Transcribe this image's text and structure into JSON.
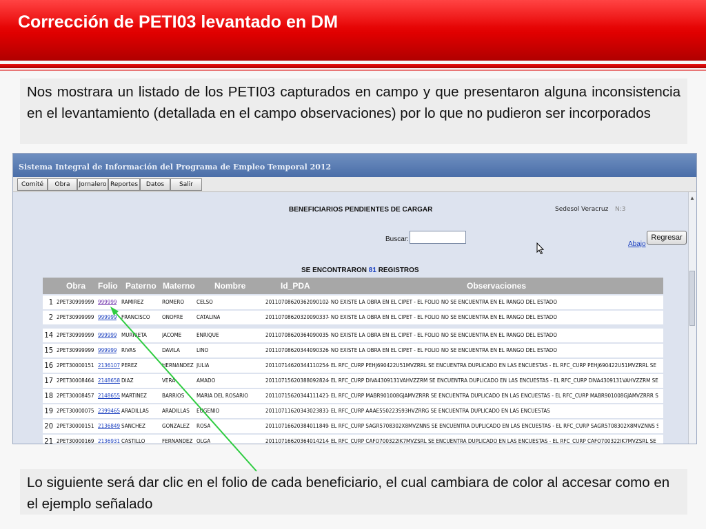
{
  "slide": {
    "title": "Corrección de PETI03 levantado en DM",
    "intro_text": "Nos mostrara un listado de los PETI03 capturados en campo y que presentaron alguna inconsistencia en el levantamiento (detallada en el campo observaciones) por lo que no pudieron ser incorporados",
    "footer_text": "Lo siguiente será dar clic en el folio de cada beneficiario, el cual cambiara de color al accesar como en el ejemplo señalado"
  },
  "app": {
    "title": "Sistema Integral de Información del Programa de Empleo Temporal 2012",
    "toolbar": [
      "Comité",
      "Obra",
      "Jornalero",
      "Reportes",
      "Datos",
      "Salir"
    ],
    "user": "Sedesol Veracruz",
    "user_suffix": "N:3"
  },
  "page": {
    "heading": "BENEFICIARIOS PENDIENTES DE CARGAR",
    "search_label": "Buscar:",
    "search_value": "",
    "back_button": "Regresar",
    "down_link": "Abajo",
    "count_prefix": "SE ENCONTRARON",
    "count": "81",
    "count_suffix": "REGISTROS"
  },
  "table": {
    "columns": [
      "Obra",
      "Folio",
      "Paterno",
      "Materno",
      "Nombre",
      "Id_PDA",
      "Observaciones"
    ],
    "rows": [
      {
        "n": "1",
        "obra": "2PET30999999",
        "folio": "999999",
        "paterno": "RAMIREZ",
        "materno": "ROMERO",
        "nombre": "CELSO",
        "id": "20110708620362090102",
        "obs": "- NO EXISTE LA OBRA EN EL CIPET - EL FOLIO NO SE ENCUENTRA EN EL RANGO DEL ESTADO",
        "visited": true
      },
      {
        "n": "2",
        "obra": "2PET30999999",
        "folio": "999999",
        "paterno": "FRANCISCO",
        "materno": "ONOFRE",
        "nombre": "CATALINA",
        "id": "20110708620320090337",
        "obs": "- NO EXISTE LA OBRA EN EL CIPET - EL FOLIO NO SE ENCUENTRA EN EL RANGO DEL ESTADO",
        "visited": false
      },
      {
        "n": "14",
        "obra": "2PET30999999",
        "folio": "999999",
        "paterno": "MURRIETA",
        "materno": "JACOME",
        "nombre": "ENRIQUE",
        "id": "20110708620364090035",
        "obs": "- NO EXISTE LA OBRA EN EL CIPET - EL FOLIO NO SE ENCUENTRA EN EL RANGO DEL ESTADO",
        "visited": false
      },
      {
        "n": "15",
        "obra": "2PET30999999",
        "folio": "999999",
        "paterno": "RIVAS",
        "materno": "DAVILA",
        "nombre": "LINO",
        "id": "20110708620344090326",
        "obs": "- NO EXISTE LA OBRA EN EL CIPET - EL FOLIO NO SE ENCUENTRA EN EL RANGO DEL ESTADO",
        "visited": false
      },
      {
        "n": "16",
        "obra": "2PET30000151",
        "folio": "2136107",
        "paterno": "PEREZ",
        "materno": "HERNANDEZ",
        "nombre": "JULIA",
        "id": "20110714620344110254",
        "obs": "- EL RFC_CURP PEHJ690422U51MVZRRL SE ENCUENTRA DUPLICADO EN LAS ENCUESTAS - EL RFC_CURP PEHJ690422U51MVZRRL SE",
        "visited": false
      },
      {
        "n": "17",
        "obra": "2PET30008464",
        "folio": "2148658",
        "paterno": "DIAZ",
        "materno": "VERA",
        "nombre": "AMADO",
        "id": "20110715620388092824",
        "obs": "- EL RFC_CURP DIVA4309131VAHVZZRM SE ENCUENTRA DUPLICADO EN LAS ENCUESTAS - EL RFC_CURP DIVA4309131VAHVZZRM SE",
        "visited": false
      },
      {
        "n": "18",
        "obra": "2PET30008457",
        "folio": "2148655",
        "paterno": "MARTINEZ",
        "materno": "BARRIOS",
        "nombre": "MARIA DEL ROSARIO",
        "id": "20110715620344111421",
        "obs": "- EL RFC_CURP MABR901008GJAMVZRRR SE ENCUENTRA DUPLICADO EN LAS ENCUESTAS - EL RFC_CURP MABR901008GJAMVZRRR SE",
        "visited": false
      },
      {
        "n": "19",
        "obra": "2PET30000075",
        "folio": "2399465",
        "paterno": "ARADILLAS",
        "materno": "ARADILLAS",
        "nombre": "EUGENIO",
        "id": "20110711620343023831",
        "obs": "- EL RFC_CURP AAAE550223S93HVZRRG SE ENCUENTRA DUPLICADO EN LAS ENCUESTAS",
        "visited": false
      },
      {
        "n": "20",
        "obra": "2PET30000151",
        "folio": "2136849",
        "paterno": "SANCHEZ",
        "materno": "GONZALEZ",
        "nombre": "ROSA",
        "id": "20110716620384011849",
        "obs": "- EL RFC_CURP SAGR5708302X8MVZNNS SE ENCUENTRA DUPLICADO EN LAS ENCUESTAS - EL RFC_CURP SAGR5708302X8MVZNNS SE",
        "visited": false
      },
      {
        "n": "21",
        "obra": "2PET30000169",
        "folio": "2136931",
        "paterno": "CASTILLO",
        "materno": "FERNANDEZ",
        "nombre": "OLGA",
        "id": "20110716620364014214",
        "obs": "- EL RFC_CURP CAFO700322IK7MVZSRL SE ENCUENTRA DUPLICADO EN LAS ENCUESTAS - EL RFC_CURP CAFO700322IK7MVZSRL SE",
        "visited": false
      }
    ]
  },
  "colors": {
    "header_red": "#e00000",
    "link": "#1a3fbf",
    "visited_link": "#6a2aa8",
    "arrow": "#2ecc40"
  }
}
